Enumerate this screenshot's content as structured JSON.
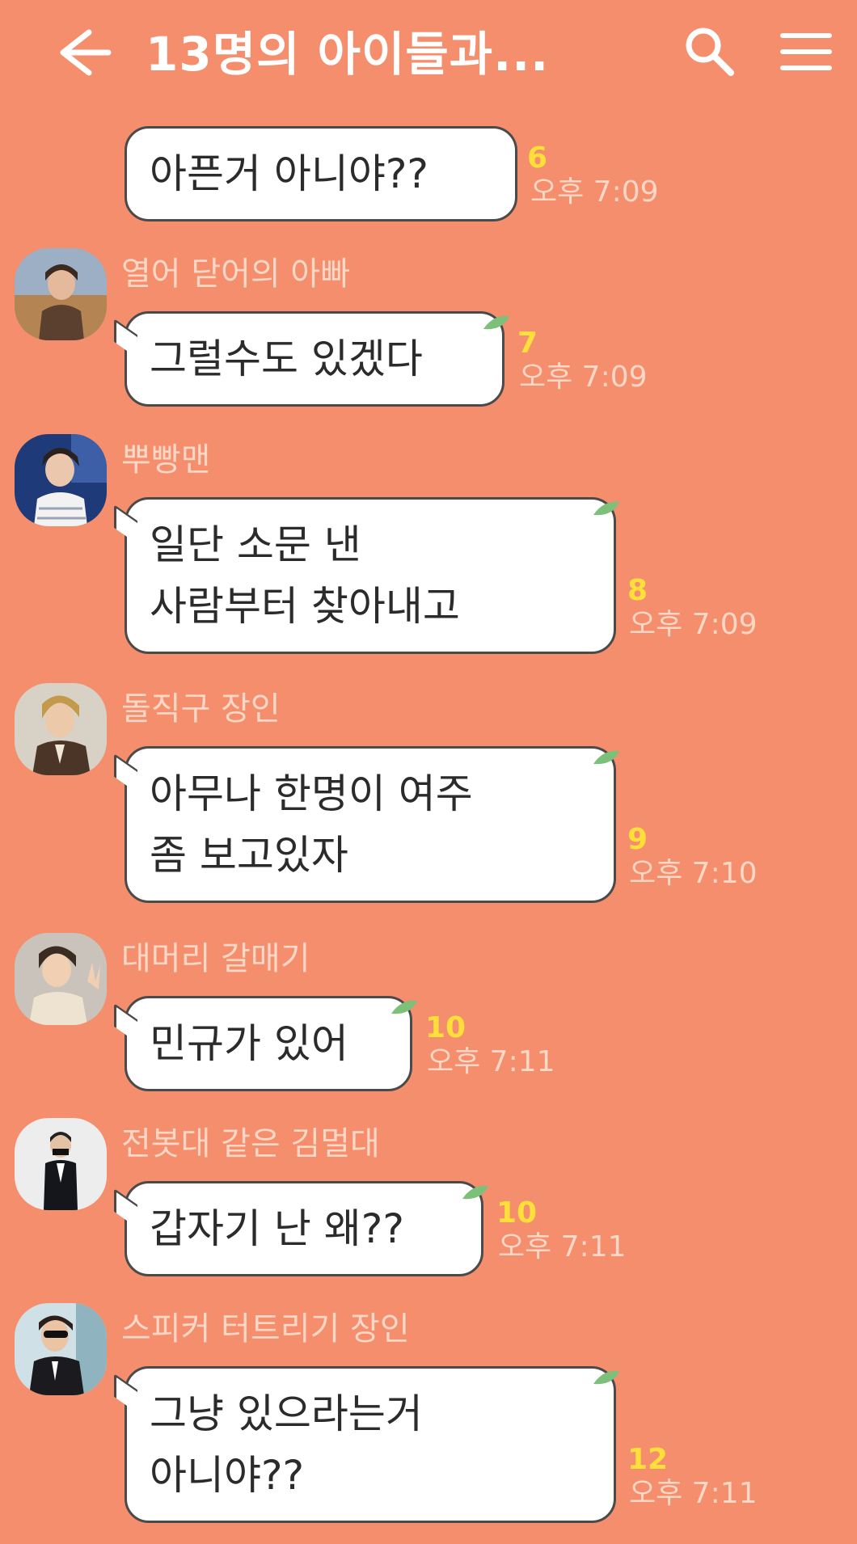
{
  "header": {
    "title": "13명의 아이들과...",
    "back_icon": "arrow-left-icon",
    "search_icon": "search-icon",
    "menu_icon": "hamburger-menu-icon"
  },
  "colors": {
    "background": "#F48E6C",
    "bubble": "#FFFFFF",
    "unread": "#FFE03A",
    "time": "#FCD7C6",
    "leaf": "#7CC07A"
  },
  "messages": [
    {
      "sender": "",
      "lines": [
        "아픈거 아니야??"
      ],
      "unread": "6",
      "time": "오후 7:09"
    },
    {
      "sender": "열어 닫어의 아빠",
      "lines": [
        "그럴수도 있겠다"
      ],
      "unread": "7",
      "time": "오후 7:09"
    },
    {
      "sender": "뿌빵맨",
      "lines": [
        "일단 소문 낸",
        "사람부터 찾아내고"
      ],
      "unread": "8",
      "time": "오후 7:09"
    },
    {
      "sender": "돌직구 장인",
      "lines": [
        "아무나 한명이 여주",
        "좀 보고있자"
      ],
      "unread": "9",
      "time": "오후 7:10"
    },
    {
      "sender": "대머리 갈매기",
      "lines": [
        "민규가 있어"
      ],
      "unread": "10",
      "time": "오후 7:11"
    },
    {
      "sender": "전봇대 같은 김멀대",
      "lines": [
        "갑자기 난 왜??"
      ],
      "unread": "10",
      "time": "오후 7:11"
    },
    {
      "sender": "스피커 터트리기 장인",
      "lines": [
        "그냥 있으라는거",
        "아니야??"
      ],
      "unread": "12",
      "time": "오후 7:11"
    }
  ]
}
